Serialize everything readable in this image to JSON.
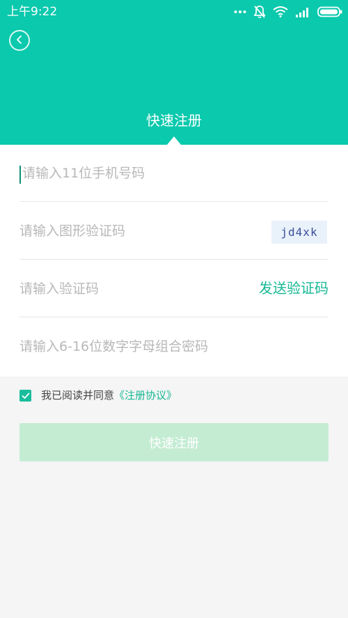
{
  "status_bar": {
    "time": "上午9:22",
    "icons": [
      "more-dots-icon",
      "bell-muted-icon",
      "wifi-icon",
      "signal-icon",
      "battery-icon"
    ]
  },
  "header": {
    "title": "快速注册",
    "background_color": "#0bc9ad",
    "back_icon": "chevron-left-icon"
  },
  "form": {
    "phone_placeholder": "请输入11位手机号码",
    "image_captcha_placeholder": "请输入图形验证码",
    "captcha_text": "jd4xk",
    "sms_code_placeholder": "请输入验证码",
    "send_code_label": "发送验证码",
    "password_placeholder": "请输入6-16位数字字母组合密码"
  },
  "agreement": {
    "checked": true,
    "text": "我已阅读并同意",
    "link": "《注册协议》"
  },
  "submit": {
    "label": "快速注册"
  },
  "colors": {
    "accent": "#17b894",
    "button_disabled": "#c4ecd3",
    "page_background": "#f5f5f5"
  }
}
